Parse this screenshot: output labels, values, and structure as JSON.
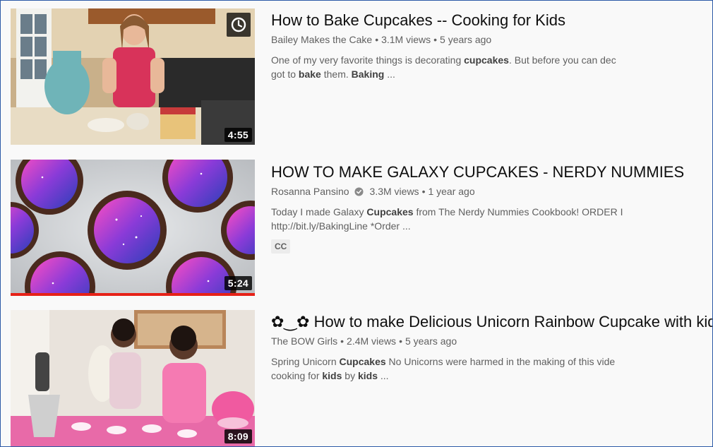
{
  "results": [
    {
      "title": "How to Bake Cupcakes -- Cooking for Kids",
      "channel": "Bailey Makes the Cake",
      "views": "3.1M views",
      "age": "5 years ago",
      "description_parts": [
        {
          "text": "One of my very favorite things is decorating ",
          "bold": false
        },
        {
          "text": "cupcakes",
          "bold": true
        },
        {
          "text": ". But before you can dec\ngot to ",
          "bold": false
        },
        {
          "text": "bake",
          "bold": true
        },
        {
          "text": " them. ",
          "bold": false
        },
        {
          "text": "Baking",
          "bold": true
        },
        {
          "text": " ...",
          "bold": false
        }
      ],
      "duration": "4:55",
      "watch_later_icon": "clock-icon",
      "verified": false,
      "badge": null
    },
    {
      "title": "HOW TO MAKE GALAXY CUPCAKES - NERDY NUMMIES",
      "channel": "Rosanna Pansino",
      "views": "3.3M views",
      "age": "1 year ago",
      "description_parts": [
        {
          "text": "Today I made Galaxy ",
          "bold": false
        },
        {
          "text": "Cupcakes",
          "bold": true
        },
        {
          "text": " from The Nerdy Nummies Cookbook! ORDER I\nhttp://bit.ly/BakingLine *Order ...",
          "bold": false
        }
      ],
      "duration": "5:24",
      "verified": true,
      "verified_icon": "verified-check-icon",
      "badge": "CC",
      "watched_progress": 1.0,
      "progress_color": "#e62117"
    },
    {
      "title": "✿‿✿ How to make Delicious Unicorn Rainbow Cupcake with kids",
      "channel": "The BOW Girls",
      "views": "2.4M views",
      "age": "5 years ago",
      "description_parts": [
        {
          "text": "Spring Unicorn ",
          "bold": false
        },
        {
          "text": "Cupcakes",
          "bold": true
        },
        {
          "text": " No Unicorns were harmed in the making of this vide\ncooking for ",
          "bold": false
        },
        {
          "text": "kids",
          "bold": true
        },
        {
          "text": " by ",
          "bold": false
        },
        {
          "text": "kids",
          "bold": true
        },
        {
          "text": " ...",
          "bold": false
        }
      ],
      "duration": "8:09",
      "verified": false,
      "badge": null
    }
  ],
  "separator": "•",
  "colors": {
    "border": "#2c5aa8",
    "background": "#f9f9f9",
    "title": "#0f0f0f",
    "secondary": "#606060",
    "progress": "#e62117"
  }
}
